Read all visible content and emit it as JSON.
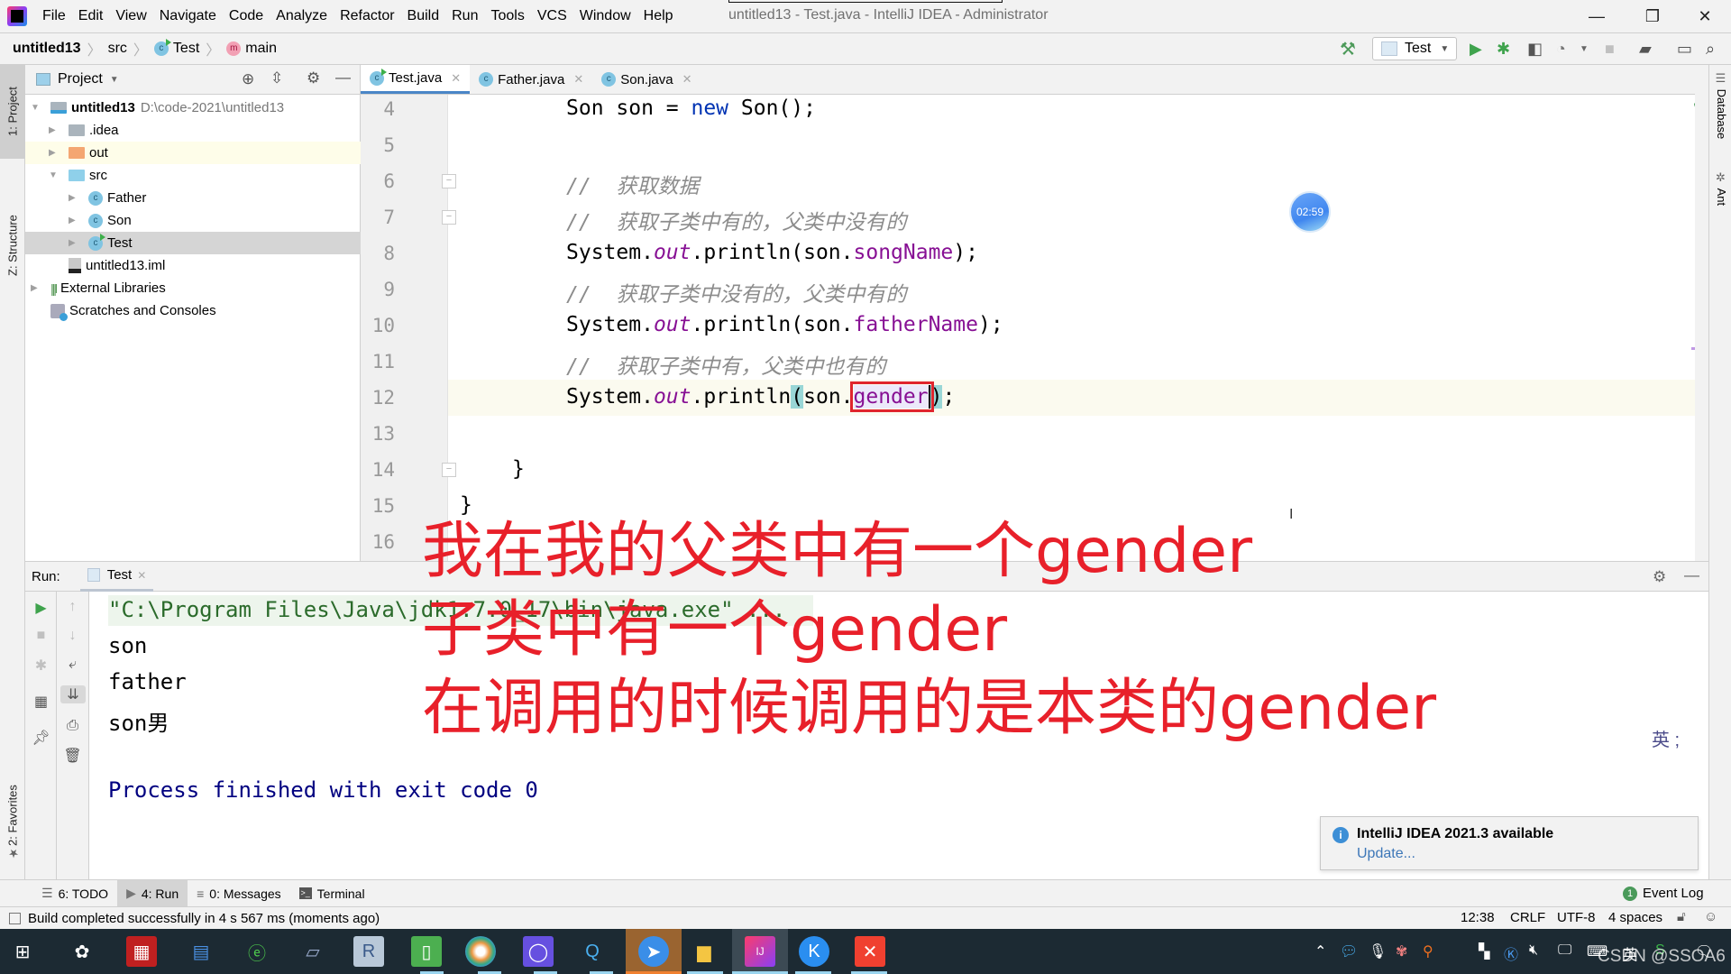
{
  "window": {
    "title": "untitled13 - Test.java - IntelliJ IDEA - Administrator",
    "menu": [
      "File",
      "Edit",
      "View",
      "Navigate",
      "Code",
      "Analyze",
      "Refactor",
      "Build",
      "Run",
      "Tools",
      "VCS",
      "Window",
      "Help"
    ],
    "controls": {
      "minimize": "—",
      "restore": "❐",
      "close": "✕"
    }
  },
  "breadcrumb": {
    "project": "untitled13",
    "folder": "src",
    "class": "Test",
    "method": "main"
  },
  "toolbar": {
    "run_config": "Test",
    "icons": [
      "build-hammer-icon",
      "run-icon",
      "debug-icon",
      "coverage-icon",
      "profile-icon",
      "stop-icon",
      "project-structure-icon",
      "presentation-icon",
      "search-icon"
    ]
  },
  "left_stripe": {
    "project_tab": "1: Project",
    "structure_tab": "Z: Structure",
    "favorites_tab": "2: Favorites"
  },
  "right_stripe": {
    "database_tab": "Database",
    "ant_tab": "Ant"
  },
  "project_panel": {
    "title": "Project",
    "tree": [
      {
        "label": "untitled13",
        "path": "D:\\code-2021\\untitled13",
        "level": 0,
        "expanded": true,
        "type": "module"
      },
      {
        "label": ".idea",
        "level": 1,
        "expanded": false,
        "type": "folder-gray"
      },
      {
        "label": "out",
        "level": 1,
        "expanded": false,
        "type": "folder-orange",
        "highlighted": true
      },
      {
        "label": "src",
        "level": 1,
        "expanded": true,
        "type": "folder-blue"
      },
      {
        "label": "Father",
        "level": 2,
        "expanded": false,
        "type": "class"
      },
      {
        "label": "Son",
        "level": 2,
        "expanded": false,
        "type": "class"
      },
      {
        "label": "Test",
        "level": 2,
        "expanded": false,
        "type": "class-runnable",
        "selected": true
      },
      {
        "label": "untitled13.iml",
        "level": 1,
        "type": "iml"
      },
      {
        "label": "External Libraries",
        "level": 0,
        "expanded": false,
        "type": "libraries"
      },
      {
        "label": "Scratches and Consoles",
        "level": 0,
        "type": "scratches"
      }
    ]
  },
  "editor": {
    "tabs": [
      {
        "label": "Test.java",
        "active": true
      },
      {
        "label": "Father.java",
        "active": false
      },
      {
        "label": "Son.java",
        "active": false
      }
    ],
    "lines": [
      {
        "n": "4",
        "text": "Son son = new Son();"
      },
      {
        "n": "5",
        "text": ""
      },
      {
        "n": "6",
        "text": "// 获取数据"
      },
      {
        "n": "7",
        "text": "// 获取子类中有的，父类中没有的"
      },
      {
        "n": "8",
        "text": "System.out.println(son.songName);"
      },
      {
        "n": "9",
        "text": "// 获取子类中没有的，父类中有的"
      },
      {
        "n": "10",
        "text": "System.out.println(son.fatherName);"
      },
      {
        "n": "11",
        "text": "// 获取子类中有，父类中也有的"
      },
      {
        "n": "12",
        "text": "System.out.println(son.gender);"
      },
      {
        "n": "13",
        "text": ""
      },
      {
        "n": "14",
        "text": "}"
      },
      {
        "n": "15",
        "text": "}"
      },
      {
        "n": "16",
        "text": ""
      }
    ],
    "tokens": {
      "l4_type": "Son",
      "l4_var": " son = ",
      "l4_new": "new",
      "l4_rest": " Son();",
      "c6": "//  获取数据",
      "c7": "//  获取子类中有的，父类中没有的",
      "c9": "//  获取子类中没有的，父类中有的",
      "c11": "//  获取子类中有，父类中也有的",
      "sys": "System.",
      "out": "out",
      "println": ".println(",
      "son": "son.",
      "f8": "songName",
      "f10": "fatherName",
      "f12": "gender",
      "close": ");",
      "paren_open": "(",
      "paren_close": ")",
      "semi": ";",
      "brace": "}"
    },
    "timer_badge": "02:59"
  },
  "annotation": {
    "line1": "我在我的父类中有一个gender",
    "line2": "子类中有一个gender",
    "line3": "在调用的时候调用的是本类的gender",
    "color": "#e8202a"
  },
  "run_panel": {
    "label": "Run:",
    "tab": "Test",
    "output": [
      "\"C:\\Program Files\\Java\\jdk1.7.0_17\\bin\\java.exe\" ...",
      "son",
      "father",
      "son男",
      "",
      "Process finished with exit code 0"
    ],
    "ime_indicator": "英 ;"
  },
  "notification": {
    "title": "IntelliJ IDEA 2021.3 available",
    "link": "Update..."
  },
  "tool_tabs": [
    {
      "label": "6: TODO",
      "active": false
    },
    {
      "label": "4: Run",
      "active": true
    },
    {
      "label": "0: Messages",
      "active": false
    },
    {
      "label": "Terminal",
      "active": false
    }
  ],
  "event_log": {
    "count": "1",
    "label": "Event Log"
  },
  "status_bar": {
    "message": "Build completed successfully in 4 s 567 ms (moments ago)",
    "position": "12:38",
    "line_sep": "CRLF",
    "encoding": "UTF-8",
    "indent": "4 spaces"
  },
  "taskbar": {
    "apps": [
      "start",
      "app-butterfly",
      "app-red-grid",
      "app-window",
      "app-ie",
      "app-notepad",
      "app-r",
      "app-green-book",
      "app-chrome",
      "app-purple",
      "app-q-search",
      "app-feishu",
      "app-explorer",
      "app-intellij",
      "app-kugou",
      "app-xmind"
    ],
    "watermark": "CSDN @SSOA6"
  }
}
